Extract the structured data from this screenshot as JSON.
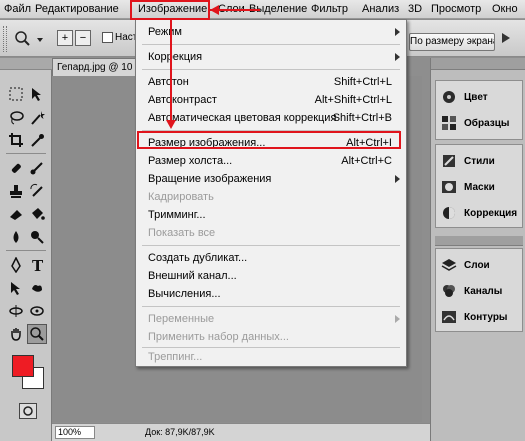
{
  "menubar": {
    "items": [
      "Файл",
      "Редактирование",
      "Изображение",
      "Слои",
      "Выделение",
      "Фильтр",
      "Анализ",
      "3D",
      "Просмотр",
      "Окно"
    ]
  },
  "options": {
    "checkbox_label": "Наст",
    "fit_screen": "По размеру экрана",
    "zoom_in_glyph": "+",
    "zoom_out_glyph": "−"
  },
  "document": {
    "tab_title": "Гепард.jpg @ 10",
    "zoom": "100%",
    "doc_info": "Док: 87,9K/87,9K"
  },
  "menu": {
    "items": [
      {
        "label": "Режим",
        "shortcut": "",
        "submenu": true,
        "disabled": false
      },
      {
        "label": "Коррекция",
        "shortcut": "",
        "submenu": true,
        "disabled": false
      },
      {
        "label": "Автотон",
        "shortcut": "Shift+Ctrl+L",
        "submenu": false,
        "disabled": false
      },
      {
        "label": "Автоконтраст",
        "shortcut": "Alt+Shift+Ctrl+L",
        "submenu": false,
        "disabled": false
      },
      {
        "label": "Автоматическая цветовая коррекция",
        "shortcut": "Shift+Ctrl+B",
        "submenu": false,
        "disabled": false
      },
      {
        "label": "Размер изображения...",
        "shortcut": "Alt+Ctrl+I",
        "submenu": false,
        "disabled": false
      },
      {
        "label": "Размер холста...",
        "shortcut": "Alt+Ctrl+C",
        "submenu": false,
        "disabled": false
      },
      {
        "label": "Вращение изображения",
        "shortcut": "",
        "submenu": true,
        "disabled": false
      },
      {
        "label": "Кадрировать",
        "shortcut": "",
        "submenu": false,
        "disabled": true
      },
      {
        "label": "Тримминг...",
        "shortcut": "",
        "submenu": false,
        "disabled": false
      },
      {
        "label": "Показать все",
        "shortcut": "",
        "submenu": false,
        "disabled": true
      },
      {
        "label": "Создать дубликат...",
        "shortcut": "",
        "submenu": false,
        "disabled": false
      },
      {
        "label": "Внешний канал...",
        "shortcut": "",
        "submenu": false,
        "disabled": false
      },
      {
        "label": "Вычисления...",
        "shortcut": "",
        "submenu": false,
        "disabled": false
      },
      {
        "label": "Переменные",
        "shortcut": "",
        "submenu": true,
        "disabled": true
      },
      {
        "label": "Применить набор данных...",
        "shortcut": "",
        "submenu": false,
        "disabled": true
      },
      {
        "label": "Треппинг...",
        "shortcut": "",
        "submenu": false,
        "disabled": true
      }
    ]
  },
  "panels": {
    "group1": [
      "Цвет",
      "Образцы"
    ],
    "group2": [
      "Стили",
      "Маски",
      "Коррекция"
    ],
    "group3": [
      "Слои",
      "Каналы",
      "Контуры"
    ]
  },
  "colors": {
    "highlight": "#e0141c",
    "foreground": "#ee1c24",
    "background": "#ffffff"
  },
  "icons": {
    "tools": [
      "marquee-icon",
      "move-icon",
      "lasso-icon",
      "magic-wand-icon",
      "crop-icon",
      "eyedropper-icon",
      "healing-brush-icon",
      "brush-icon",
      "clone-stamp-icon",
      "history-brush-icon",
      "eraser-icon",
      "paint-bucket-icon",
      "blur-icon",
      "dodge-icon",
      "pen-icon",
      "type-icon",
      "path-selection-icon",
      "shape-icon",
      "3d-rotate-icon",
      "3d-orbit-icon",
      "hand-icon",
      "zoom-icon"
    ]
  }
}
